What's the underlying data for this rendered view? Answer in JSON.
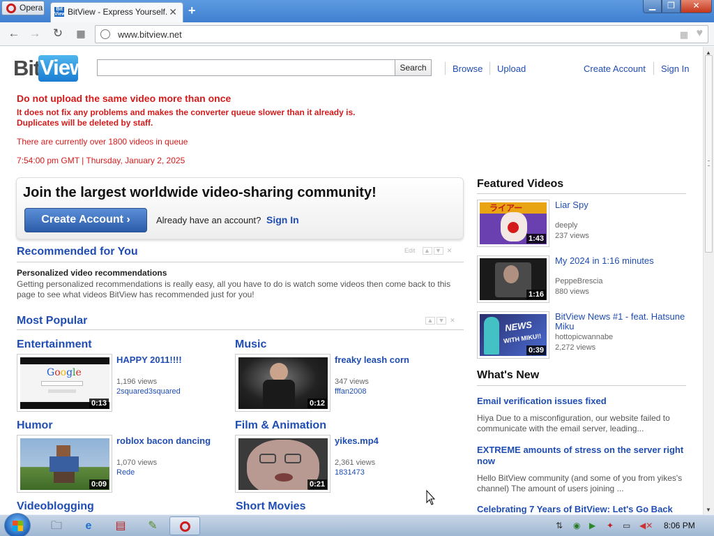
{
  "browser": {
    "menu_label": "Opera",
    "tab_title": "BitView - Express Yourself.",
    "url": "www.bitview.net",
    "window_controls": [
      "minimize",
      "maximize",
      "close"
    ]
  },
  "site": {
    "logo": {
      "bit": "Bit",
      "view": "View"
    },
    "search": {
      "button_label": "Search",
      "placeholder": ""
    },
    "nav": {
      "browse": "Browse",
      "upload": "Upload",
      "create_account": "Create Account",
      "sign_in": "Sign In"
    }
  },
  "notice": {
    "title": "Do not upload the same video more than once",
    "line1": "It does not fix any problems and makes the converter queue slower than it already is.",
    "line2": "Duplicates will be deleted by staff.",
    "queue": "There are currently over 1800 videos in queue",
    "timestamp": "7:54:00 pm GMT | Thursday, January 2, 2025"
  },
  "join": {
    "headline": "Join the largest worldwide video-sharing community!",
    "create_button": "Create Account ›",
    "already": "Already have an account?",
    "sign_in": "Sign In"
  },
  "recommended": {
    "title": "Recommended for You",
    "edit": "Edit",
    "heading": "Personalized video recommendations",
    "text": "Getting personalized recommendations is really easy, all you have to do is watch some videos then come back to this page to see what videos BitView has recommended just for you!"
  },
  "most_popular": {
    "title": "Most Popular",
    "categories": [
      {
        "name": "Entertainment",
        "video": {
          "title": "HAPPY 2011!!!!",
          "views": "1,196 views",
          "user": "2squared3squared",
          "duration": "0:13"
        }
      },
      {
        "name": "Music",
        "video": {
          "title": "freaky leash corn",
          "views": "347 views",
          "user": "fffan2008",
          "duration": "0:12"
        }
      },
      {
        "name": "Humor",
        "video": {
          "title": "roblox bacon dancing",
          "views": "1,070 views",
          "user": "Rede",
          "duration": "0:09"
        }
      },
      {
        "name": "Film & Animation",
        "video": {
          "title": "yikes.mp4",
          "views": "2,361 views",
          "user": "1831473",
          "duration": "0:21"
        }
      },
      {
        "name": "Videoblogging"
      },
      {
        "name": "Short Movies"
      }
    ]
  },
  "featured": {
    "title": "Featured Videos",
    "videos": [
      {
        "title": "Liar Spy",
        "user": "deeply",
        "views": "237 views",
        "duration": "1:43"
      },
      {
        "title": "My 2024 in 1:16 minutes",
        "user": "PeppeBrescia",
        "views": "880 views",
        "duration": "1:16"
      },
      {
        "title": "BitView News #1 - feat. Hatsune Miku",
        "user": "hottopicwannabe",
        "views": "2,272 views",
        "duration": "0:39"
      }
    ]
  },
  "whats_new": {
    "title": "What's New",
    "items": [
      {
        "title": "Email verification issues fixed",
        "body": "Hiya Due to a misconfiguration, our website failed to communicate with the email server, leading..."
      },
      {
        "title": "EXTREME amounts of stress on the server right now",
        "body": "Hello BitView community (and some of you from yikes's channel) The amount of users joining ..."
      },
      {
        "title": "Celebrating 7 Years of BitView: Let's Go Back"
      }
    ]
  },
  "taskbar": {
    "clock": "8:06 PM"
  },
  "colors": {
    "link": "#1f4db3",
    "warning": "#d41b1b",
    "accent": "#2c5ca8"
  }
}
